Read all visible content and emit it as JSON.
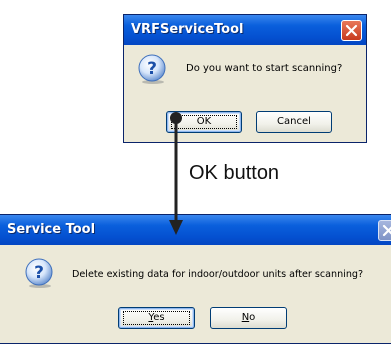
{
  "dialog1": {
    "title": "VRFServiceTool",
    "message": "Do you want to start scanning?",
    "ok_label": "OK",
    "cancel_label": "Cancel",
    "icon": "question-icon"
  },
  "dialog2": {
    "title": "Service Tool",
    "message": "Delete existing data for indoor/outdoor units after scanning?",
    "yes_mnemonic": "Y",
    "yes_rest": "es",
    "no_mnemonic": "N",
    "no_rest": "o",
    "icon": "question-icon"
  },
  "annotation": {
    "label": "OK button"
  },
  "colors": {
    "titlebar": "#0450d0",
    "dialog_bg": "#ece9d8",
    "close_red": "#c73a1e",
    "arrow": "#222222"
  }
}
